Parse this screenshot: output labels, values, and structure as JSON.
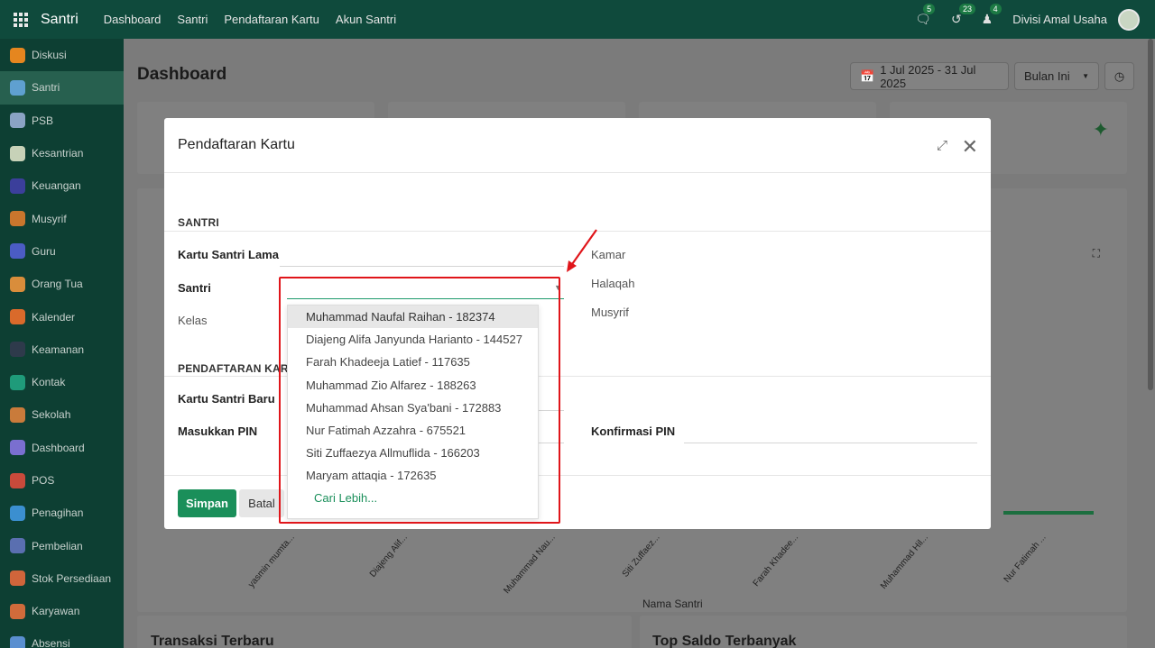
{
  "app": {
    "brand": "Santri",
    "nav": [
      "Dashboard",
      "Santri",
      "Pendaftaran Kartu",
      "Akun Santri"
    ],
    "notifications": [
      {
        "icon": "chat-icon",
        "count": "5"
      },
      {
        "icon": "activity-icon",
        "count": "23"
      },
      {
        "icon": "user-bell-icon",
        "count": "4"
      }
    ],
    "company": "Divisi Amal Usaha"
  },
  "sidebar": {
    "items": [
      {
        "label": "Diskusi",
        "icon": "discuss-icon",
        "color": "#e5861f"
      },
      {
        "label": "Santri",
        "icon": "student-icon",
        "color": "#5fa0d0",
        "active": true
      },
      {
        "label": "PSB",
        "icon": "document-icon",
        "color": "#8aa3c4"
      },
      {
        "label": "Kesantrian",
        "icon": "mosque-icon",
        "color": "#c7d2b8"
      },
      {
        "label": "Keuangan",
        "icon": "dollar-icon",
        "color": "#3b3f9b"
      },
      {
        "label": "Musyrif",
        "icon": "teacher-icon",
        "color": "#c9762d"
      },
      {
        "label": "Guru",
        "icon": "board-icon",
        "color": "#4b5cc4"
      },
      {
        "label": "Orang Tua",
        "icon": "family-icon",
        "color": "#d98d3b"
      },
      {
        "label": "Kalender",
        "icon": "calendar-icon",
        "color": "#d96a2b"
      },
      {
        "label": "Keamanan",
        "icon": "security-icon",
        "color": "#2e3a4b"
      },
      {
        "label": "Kontak",
        "icon": "contact-icon",
        "color": "#1f9b7a"
      },
      {
        "label": "Sekolah",
        "icon": "school-icon",
        "color": "#c97b3b"
      },
      {
        "label": "Dashboard",
        "icon": "dashboard-icon",
        "color": "#7a6fd0"
      },
      {
        "label": "POS",
        "icon": "pos-icon",
        "color": "#c94a3b"
      },
      {
        "label": "Penagihan",
        "icon": "invoice-icon",
        "color": "#3b8fd0"
      },
      {
        "label": "Pembelian",
        "icon": "purchase-icon",
        "color": "#5a6fb0"
      },
      {
        "label": "Stok Persediaan",
        "icon": "box-icon",
        "color": "#d0653b"
      },
      {
        "label": "Karyawan",
        "icon": "employees-icon",
        "color": "#d06b3b"
      },
      {
        "label": "Absensi",
        "icon": "attendance-icon",
        "color": "#5a8fd0"
      }
    ]
  },
  "dashboard": {
    "title": "Dashboard",
    "date_range": "1 Jul 2025 - 31 Jul 2025",
    "period": "Bulan Ini",
    "x_axis_title": "Nama Santri",
    "x_labels": [
      "yasmin mumta...",
      "Diajeng Alif...",
      "Muhammad Nau...",
      "Siti Zuffaez...",
      "Farah Khadee...",
      "Muhammad Hil...",
      "Nur Fatimah ..."
    ],
    "bottom_titles": [
      "Transaksi Terbaru",
      "Top Saldo Terbanyak"
    ]
  },
  "modal": {
    "title": "Pendaftaran Kartu",
    "section_santri": "SANTRI",
    "section_kartu": "PENDAFTARAN KART",
    "labels": {
      "kartu_lama": "Kartu Santri Lama",
      "santri": "Santri",
      "kelas": "Kelas",
      "kamar": "Kamar",
      "halaqah": "Halaqah",
      "musyrif": "Musyrif",
      "kartu_baru": "Kartu Santri Baru",
      "pin": "Masukkan PIN",
      "konfirmasi_pin": "Konfirmasi PIN"
    },
    "buttons": {
      "save": "Simpan",
      "cancel": "Batal"
    }
  },
  "dropdown": {
    "options": [
      "Muhammad Naufal Raihan - 182374",
      "Diajeng Alifa Janyunda Harianto - 144527",
      "Farah Khadeeja Latief - 117635",
      "Muhammad Zio Alfarez - 188263",
      "Muhammad Ahsan Sya'bani - 172883",
      "Nur Fatimah Azzahra - 675521",
      "Siti Zuffaezya Allmuflida - 166203",
      "Maryam attaqia - 172635"
    ],
    "more": "Cari Lebih..."
  },
  "colors": {
    "topbar": "#0f4a3c",
    "sidebar": "#0d3f33",
    "primary": "#1a8f5a",
    "annotation": "#e0151a"
  }
}
